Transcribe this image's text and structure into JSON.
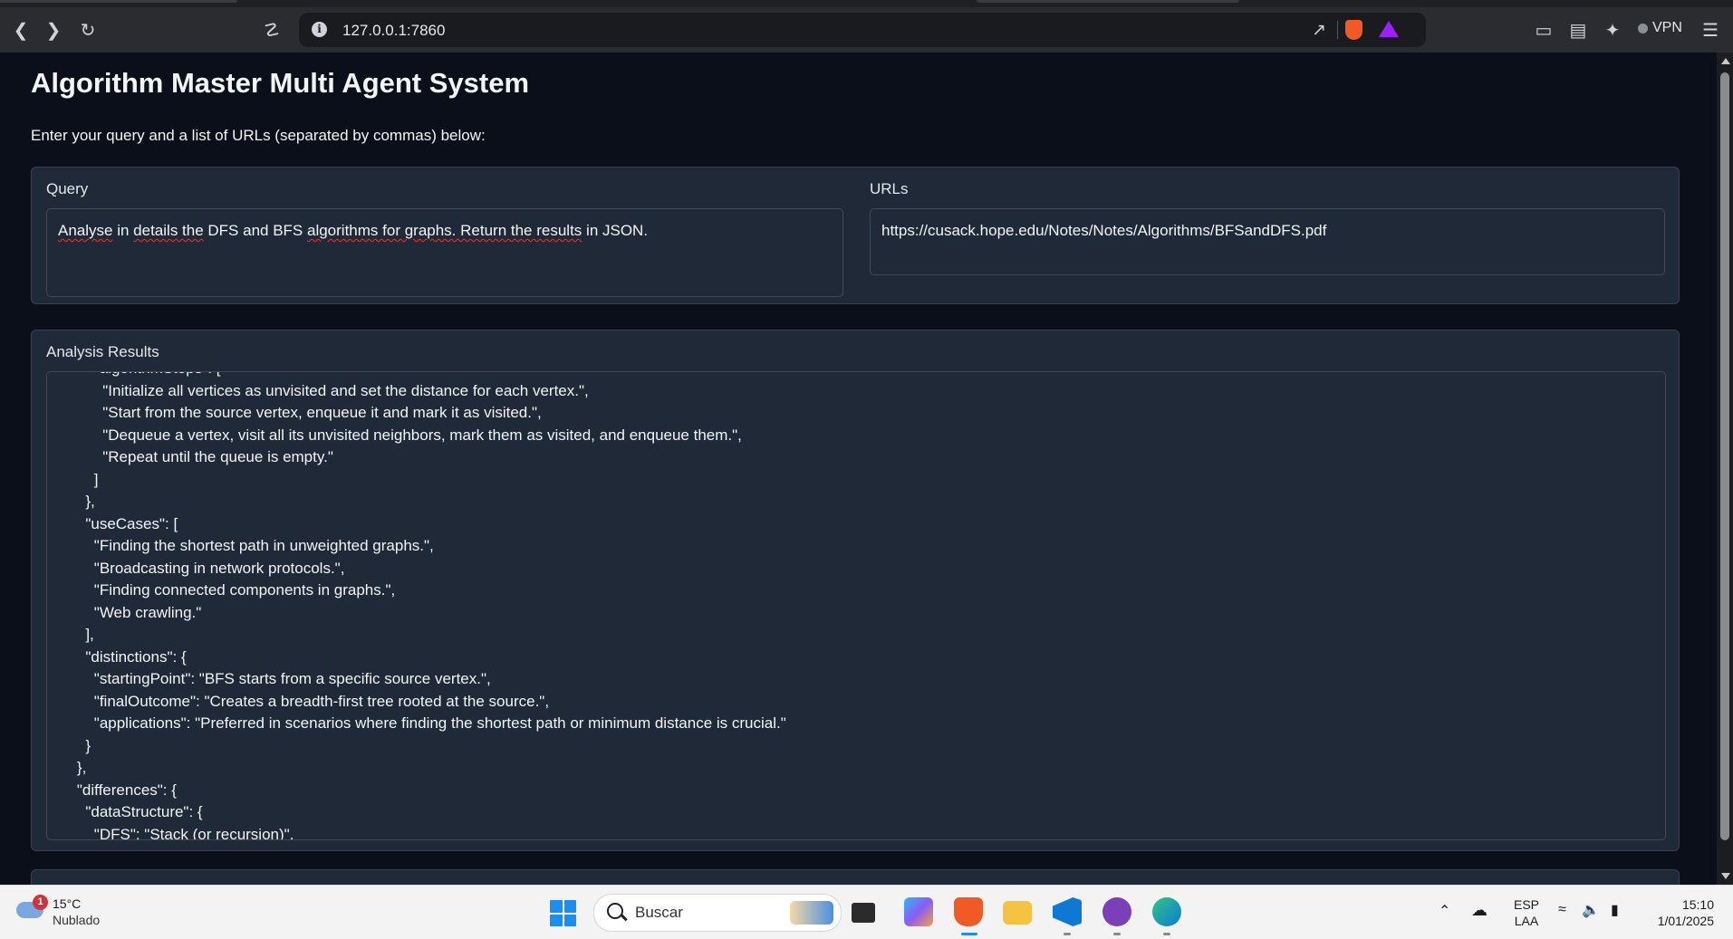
{
  "browser": {
    "url": "127.0.0.1:7860",
    "vpn_label": "VPN"
  },
  "page": {
    "title": "Algorithm Master Multi Agent System",
    "intro": "Enter your query and a list of URLs (separated by commas) below:",
    "query": {
      "label": "Query",
      "value_parts": [
        "Analyse",
        " in ",
        "details the",
        " DFS and BFS ",
        "algorithms for graphs. Return the results",
        " in JSON."
      ]
    },
    "urls": {
      "label": "URLs",
      "value": "https://cusack.hope.edu/Notes/Notes/Algorithms/BFSandDFS.pdf"
    },
    "results": {
      "label": "Analysis Results",
      "text": "        \"algorithmSteps\": [\n          \"Initialize all vertices as unvisited and set the distance for each vertex.\",\n          \"Start from the source vertex, enqueue it and mark it as visited.\",\n          \"Dequeue a vertex, visit all its unvisited neighbors, mark them as visited, and enqueue them.\",\n          \"Repeat until the queue is empty.\"\n        ]\n      },\n      \"useCases\": [\n        \"Finding the shortest path in unweighted graphs.\",\n        \"Broadcasting in network protocols.\",\n        \"Finding connected components in graphs.\",\n        \"Web crawling.\"\n      ],\n      \"distinctions\": {\n        \"startingPoint\": \"BFS starts from a specific source vertex.\",\n        \"finalOutcome\": \"Creates a breadth-first tree rooted at the source.\",\n        \"applications\": \"Preferred in scenarios where finding the shortest path or minimum distance is crucial.\"\n      }\n    },\n    \"differences\": {\n      \"dataStructure\": {\n        \"DFS\": \"Stack (or recursion)\","
    }
  },
  "taskbar": {
    "weather_temp": "15°C",
    "weather_condition": "Nublado",
    "weather_badge": "1",
    "search_placeholder": "Buscar",
    "lang_top": "ESP",
    "lang_bottom": "LAA",
    "time": "15:10",
    "date": "1/01/2025"
  },
  "colors": {
    "page_bg": "#0b0f19",
    "panel_bg": "#1f2937",
    "taskbar_bg": "#f3f3f3",
    "brave_orange": "#f15a24",
    "win_blue": "#1c8ef0"
  }
}
